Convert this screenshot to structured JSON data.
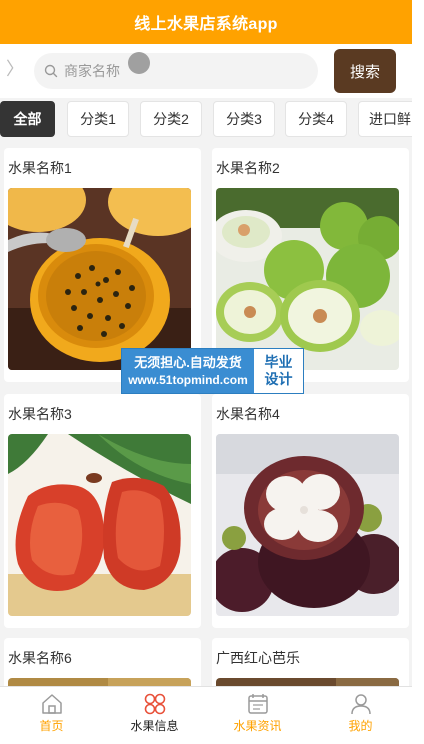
{
  "app": {
    "title": "线上水果店系统app"
  },
  "search": {
    "placeholder": "商家名称",
    "button_label": "搜索",
    "back_glyph": "〉"
  },
  "categories": [
    {
      "label": "全部",
      "active": true
    },
    {
      "label": "分类1",
      "active": false
    },
    {
      "label": "分类2",
      "active": false
    },
    {
      "label": "分类3",
      "active": false
    },
    {
      "label": "分类4",
      "active": false
    },
    {
      "label": "进口鲜",
      "active": false
    }
  ],
  "products": [
    {
      "name": "水果名称1",
      "image": "passion-fruit-image"
    },
    {
      "name": "水果名称2",
      "image": "green-jujube-image"
    },
    {
      "name": "水果名称3",
      "image": "wax-apple-image"
    },
    {
      "name": "水果名称4",
      "image": "mangosteen-image"
    },
    {
      "name": "水果名称6",
      "image": "product-image"
    },
    {
      "name": "广西红心芭乐",
      "image": "guava-image"
    }
  ],
  "watermark": {
    "line1": "无须担心.自动发货",
    "line2": "www.51topmind.com",
    "side1": "毕业",
    "side2": "设计"
  },
  "nav": [
    {
      "label": "首页",
      "icon": "home-icon",
      "active": false
    },
    {
      "label": "水果信息",
      "icon": "fruit-grid-icon",
      "active": true
    },
    {
      "label": "水果资讯",
      "icon": "news-icon",
      "active": false
    },
    {
      "label": "我的",
      "icon": "profile-icon",
      "active": false
    }
  ],
  "colors": {
    "header": "#ffa200",
    "search_button": "#5a3a22",
    "active_tab": "#343434",
    "nav_text": "#ffa200",
    "nav_active_icon": "#e8513a"
  }
}
